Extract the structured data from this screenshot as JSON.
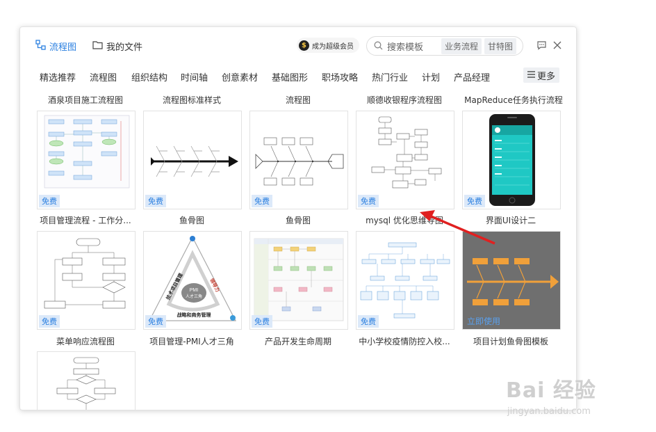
{
  "header": {
    "tab_flowchart": "流程图",
    "tab_myfiles": "我的文件",
    "vip_label": "成为超级会员",
    "search_placeholder": "搜索模板",
    "chip1": "业务流程",
    "chip2": "甘特图"
  },
  "categories": [
    "精选推荐",
    "流程图",
    "组织结构",
    "时间轴",
    "创意素材",
    "基础图形",
    "职场攻略",
    "热门行业",
    "计划",
    "产品经理"
  ],
  "more_label": "更多",
  "free_label": "免费",
  "use_now_label": "立即使用",
  "row_titles": [
    [
      "酒泉项目施工流程图",
      "流程图标准样式",
      "流程图",
      "顺德收银程序流程图",
      "MapReduce任务执行流程"
    ],
    [
      "项目管理流程 - 工作分...",
      "鱼骨图",
      "鱼骨图",
      "mysql 优化思维导图",
      "界面UI设计二"
    ],
    [
      "菜单响应流程图",
      "项目管理-PMI人才三角",
      "产品开发生命周期",
      "中小学校疫情防控入校...",
      "项目计划鱼骨图模板"
    ]
  ],
  "card_texts": {
    "pmi_left": "技术项目管理",
    "pmi_right": "领导力",
    "pmi_bottom": "战略和商务管理",
    "pmi_center1": "PMI",
    "pmi_center2": "人才三角"
  },
  "watermark": "Bai 经验",
  "watermark_url": "jingyan.baidu.com",
  "colors": {
    "accent": "#2a7fe0",
    "badge_bg": "#dce9f9",
    "fishbone_orange": "#f0a03a",
    "arrow_red": "#e02020"
  }
}
